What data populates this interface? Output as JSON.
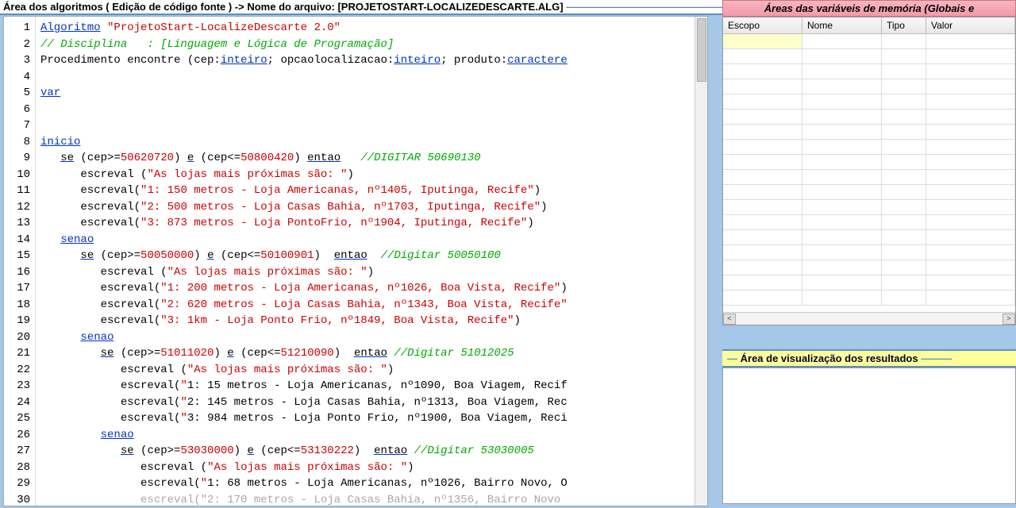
{
  "header": {
    "left": "Área dos algoritmos ( Edição de código fonte ) -> Nome do arquivo: [",
    "filename": "PROJETOSTART-LOCALIZEDESCARTE.ALG",
    "right": "]"
  },
  "gutter": [
    "1",
    "2",
    "3",
    "4",
    "5",
    "6",
    "7",
    "8",
    "9",
    "10",
    "11",
    "12",
    "13",
    "14",
    "15",
    "16",
    "17",
    "18",
    "19",
    "20",
    "21",
    "22",
    "23",
    "24",
    "25",
    "26",
    "27",
    "28",
    "29",
    "30"
  ],
  "code": [
    {
      "t": "algoritmo",
      "content": [
        "Algoritmo",
        " ",
        "\"ProjetoStart-LocalizeDescarte 2.0\""
      ]
    },
    {
      "t": "comment",
      "content": "// Disciplina   : [Linguagem e Lógica de Programação]"
    },
    {
      "t": "proc",
      "parts": {
        "p": "Procedimento encontre (cep:",
        "i1": "inteiro",
        "m1": "; opcaolocalizacao:",
        "i2": "inteiro",
        "m2": "; produto:",
        "c": "caractere"
      }
    },
    {
      "t": "blank"
    },
    {
      "t": "kw",
      "content": "var"
    },
    {
      "t": "blank"
    },
    {
      "t": "blank"
    },
    {
      "t": "kw",
      "content": "inicio"
    },
    {
      "t": "se",
      "indent": "   ",
      "p1": "se",
      "p2": " (cep>=",
      "n1": "50620720",
      "p3": ") ",
      "p4": "e",
      "p5": " (cep<=",
      "n2": "50800420",
      "p6": ") ",
      "p7": "entao",
      "sp": "   ",
      "c": "//DIGITAR 50690130"
    },
    {
      "t": "esc",
      "indent": "      ",
      "fn": "escreval ",
      "arg": "(\"As lojas mais próximas são: \")"
    },
    {
      "t": "esc",
      "indent": "      ",
      "fn": "escreval",
      "arg": "(\"1: 150 metros - Loja Americanas, nº1405, Iputinga, Recife\")"
    },
    {
      "t": "esc",
      "indent": "      ",
      "fn": "escreval",
      "arg": "(\"2: 500 metros - Loja Casas Bahia, nº1703, Iputinga, Recife\")"
    },
    {
      "t": "esc",
      "indent": "      ",
      "fn": "escreval",
      "arg": "(\"3: 873 metros - Loja PontoFrio, nº1904, Iputinga, Recife\")"
    },
    {
      "t": "kw",
      "indent": "   ",
      "content": "senao"
    },
    {
      "t": "se",
      "indent": "      ",
      "p1": "se",
      "p2": " (cep>=",
      "n1": "50050000",
      "p3": ") ",
      "p4": "e",
      "p5": " (cep<=",
      "n2": "50100901",
      "p6": ")  ",
      "p7": "entao",
      "sp": "  ",
      "c": "//Digitar 50050100"
    },
    {
      "t": "esc",
      "indent": "         ",
      "fn": "escreval ",
      "arg": "(\"As lojas mais próximas são: \")"
    },
    {
      "t": "esc",
      "indent": "         ",
      "fn": "escreval",
      "arg": "(\"1: 200 metros - Loja Americanas, nº1026, Boa Vista, Recife\")"
    },
    {
      "t": "esc",
      "indent": "         ",
      "fn": "escreval",
      "arg": "(\"2: 620 metros - Loja Casas Bahia, nº1343, Boa Vista, Recife\""
    },
    {
      "t": "esc",
      "indent": "         ",
      "fn": "escreval",
      "arg": "(\"3: 1km - Loja Ponto Frio, nº1849, Boa Vista, Recife\")"
    },
    {
      "t": "kw",
      "indent": "      ",
      "content": "senao"
    },
    {
      "t": "se",
      "indent": "         ",
      "p1": "se",
      "p2": " (cep>=",
      "n1": "51011020",
      "p3": ") ",
      "p4": "e",
      "p5": " (cep<=",
      "n2": "51210090",
      "p6": ")  ",
      "p7": "entao",
      "sp": " ",
      "c": "//Digitar 51012025"
    },
    {
      "t": "esc",
      "indent": "            ",
      "fn": "escreval ",
      "arg": "(\"As lojas mais próximas são: \")"
    },
    {
      "t": "esc",
      "indent": "            ",
      "fn": "escreval",
      "arg": "(\"1: 15 metros - Loja Americanas, nº1090, Boa Viagem, Recif"
    },
    {
      "t": "esc",
      "indent": "            ",
      "fn": "escreval",
      "arg": "(\"2: 145 metros - Loja Casas Bahia, nº1313, Boa Viagem, Rec"
    },
    {
      "t": "esc",
      "indent": "            ",
      "fn": "escreval",
      "arg": "(\"3: 984 metros - Loja Ponto Frio, nº1900, Boa Viagem, Reci"
    },
    {
      "t": "kw",
      "indent": "         ",
      "content": "senao"
    },
    {
      "t": "se",
      "indent": "            ",
      "p1": "se",
      "p2": " (cep>=",
      "n1": "53030000",
      "p3": ") ",
      "p4": "e",
      "p5": " (cep<=",
      "n2": "53130222",
      "p6": ")  ",
      "p7": "entao",
      "sp": " ",
      "c": "//Digitar 53030005"
    },
    {
      "t": "esc",
      "indent": "               ",
      "fn": "escreval ",
      "arg": "(\"As lojas mais próximas são: \")"
    },
    {
      "t": "esc",
      "indent": "               ",
      "fn": "escreval",
      "arg": "(\"1: 68 metros - Loja Americanas, nº1026, Bairro Novo, O"
    },
    {
      "t": "trunc",
      "indent": "               ",
      "content": "escreval(\"2: 170 metros - Loja Casas Bahia, nº1356, Bairro Novo"
    }
  ],
  "vars": {
    "title": "Áreas das variáveis de memória (Globais e",
    "headers": [
      "Escopo",
      "Nome",
      "Tipo",
      "Valor"
    ],
    "rows": 18
  },
  "results": {
    "title": "Área de visualização dos resultados"
  },
  "scroll": {
    "left_arrow": "<",
    "right_arrow": ">"
  }
}
